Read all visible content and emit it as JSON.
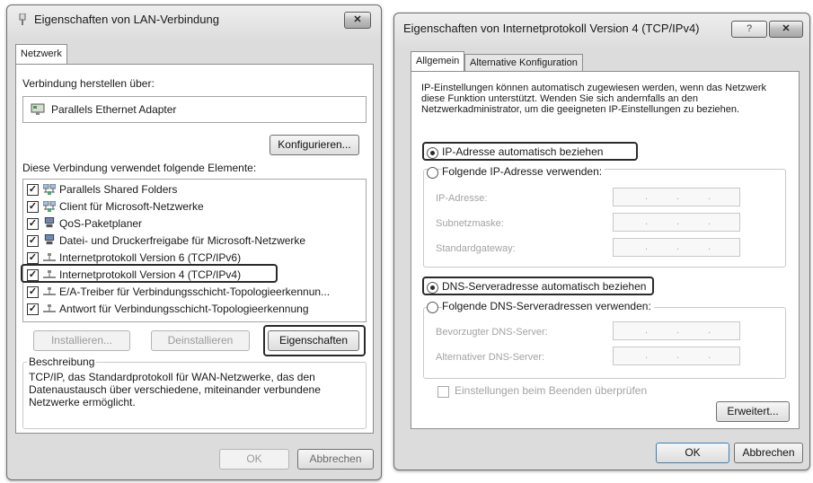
{
  "left_dialog": {
    "title": "Eigenschaften von LAN-Verbindung",
    "close_label": "✕",
    "tab": "Netzwerk",
    "connect_via_label": "Verbindung herstellen über:",
    "adapter_name": "Parallels Ethernet Adapter",
    "configure_button": "Konfigurieren...",
    "elements_label": "Diese Verbindung verwendet folgende Elemente:",
    "items": [
      {
        "label": "Parallels Shared Folders",
        "checked": true,
        "icon": "network-client-icon"
      },
      {
        "label": "Client für Microsoft-Netzwerke",
        "checked": true,
        "icon": "network-client-icon"
      },
      {
        "label": "QoS-Paketplaner",
        "checked": true,
        "icon": "computer-icon"
      },
      {
        "label": "Datei- und Druckerfreigabe für Microsoft-Netzwerke",
        "checked": true,
        "icon": "computer-icon"
      },
      {
        "label": "Internetprotokoll Version 6 (TCP/IPv6)",
        "checked": true,
        "icon": "protocol-icon"
      },
      {
        "label": "Internetprotokoll Version 4 (TCP/IPv4)",
        "checked": true,
        "icon": "protocol-icon"
      },
      {
        "label": "E/A-Treiber für Verbindungsschicht-Topologieerkennun...",
        "checked": true,
        "icon": "protocol-icon"
      },
      {
        "label": "Antwort für Verbindungsschicht-Topologieerkennung",
        "checked": true,
        "icon": "protocol-icon"
      }
    ],
    "install_button": "Installieren...",
    "uninstall_button": "Deinstallieren",
    "properties_button": "Eigenschaften",
    "description_title": "Beschreibung",
    "description_text": "TCP/IP, das Standardprotokoll für WAN-Netzwerke, das den Datenaustausch über verschiedene, miteinander verbundene Netzwerke ermöglicht.",
    "ok_button": "OK",
    "cancel_button": "Abbrechen"
  },
  "right_dialog": {
    "title": "Eigenschaften von Internetprotokoll Version 4 (TCP/IPv4)",
    "help_label": "?",
    "close_label": "✕",
    "tab_general": "Allgemein",
    "tab_alternative": "Alternative Konfiguration",
    "info_text": "IP-Einstellungen können automatisch zugewiesen werden, wenn das Netzwerk diese Funktion unterstützt. Wenden Sie sich andernfalls an den Netzwerkadministrator, um die geeigneten IP-Einstellungen zu beziehen.",
    "radio_ip_auto": "IP-Adresse automatisch beziehen",
    "radio_ip_manual": "Folgende IP-Adresse verwenden:",
    "ip_address_label": "IP-Adresse:",
    "subnet_label": "Subnetzmaske:",
    "gateway_label": "Standardgateway:",
    "radio_dns_auto": "DNS-Serveradresse automatisch beziehen",
    "radio_dns_manual": "Folgende DNS-Serveradressen verwenden:",
    "preferred_dns_label": "Bevorzugter DNS-Server:",
    "alternate_dns_label": "Alternativer DNS-Server:",
    "validate_label": "Einstellungen beim Beenden überprüfen",
    "advanced_button": "Erweitert...",
    "ok_button": "OK",
    "cancel_button": "Abbrechen",
    "ip_dot": "."
  }
}
